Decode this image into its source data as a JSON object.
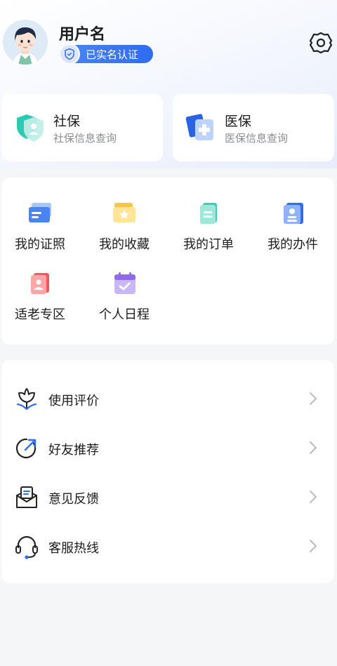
{
  "profile": {
    "username": "用户名",
    "verified_label": "已实名认证"
  },
  "services": [
    {
      "title": "社保",
      "subtitle": "社保信息查询",
      "icon": "social-security-icon"
    },
    {
      "title": "医保",
      "subtitle": "医保信息查询",
      "icon": "medical-insurance-icon"
    }
  ],
  "shortcuts": [
    {
      "label": "我的证照",
      "icon": "license-card-icon"
    },
    {
      "label": "我的收藏",
      "icon": "favorite-folder-icon"
    },
    {
      "label": "我的订单",
      "icon": "order-document-icon"
    },
    {
      "label": "我的办件",
      "icon": "case-badge-icon"
    },
    {
      "label": "适老专区",
      "icon": "elderly-zone-icon"
    },
    {
      "label": "个人日程",
      "icon": "calendar-check-icon"
    }
  ],
  "menu": [
    {
      "label": "使用评价",
      "icon": "flower-rating-icon"
    },
    {
      "label": "好友推荐",
      "icon": "share-arrow-icon"
    },
    {
      "label": "意见反馈",
      "icon": "feedback-mail-icon"
    },
    {
      "label": "客服热线",
      "icon": "headset-icon"
    }
  ],
  "colors": {
    "accent": "#2f6cf0",
    "background": "#f5f6f8",
    "card": "#ffffff",
    "muted_text": "#8a8d93"
  }
}
